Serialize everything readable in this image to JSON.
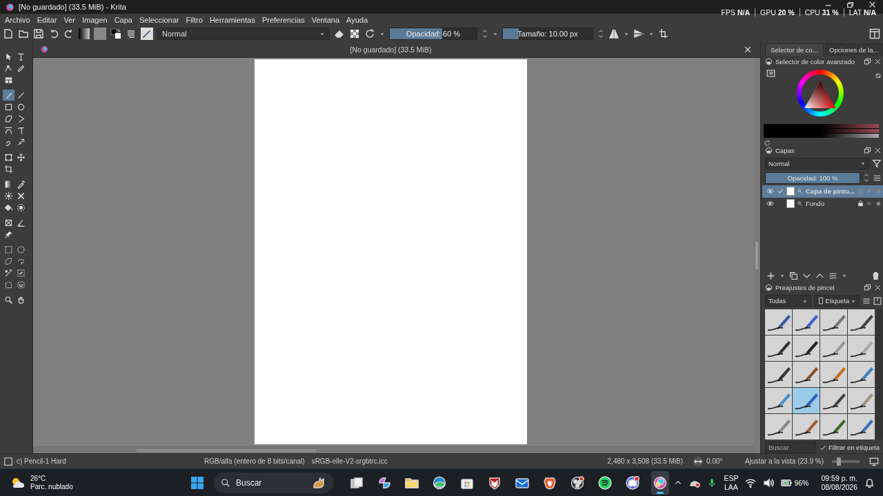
{
  "window": {
    "title": "[No guardado] (33.5 MiB) - Krita"
  },
  "performance": [
    {
      "label": "FPS",
      "value": "N/A"
    },
    {
      "label": "GPU",
      "value": "20 %"
    },
    {
      "label": "CPU",
      "value": "31 %"
    },
    {
      "label": "LAT",
      "value": "N/A"
    }
  ],
  "menu": [
    "Archivo",
    "Editar",
    "Ver",
    "Imagen",
    "Capa",
    "Seleccionar",
    "Filtro",
    "Herramientas",
    "Preferencias",
    "Ventana",
    "Ayuda"
  ],
  "toolbar": {
    "blend_mode": "Normal",
    "opacity": {
      "label": "Opacidad: 60 %",
      "level": 0.6
    },
    "size": {
      "label": "Tamaño: 10.00 px",
      "level": 0.18
    }
  },
  "document": {
    "tab_title": "[No guardado] (33.5 MiB)"
  },
  "toolbox": [
    {
      "tools": [
        {
          "kind": "pointer",
          "selected": false
        },
        {
          "kind": "text",
          "selected": false
        },
        {
          "kind": "edit-shapes",
          "selected": false
        },
        {
          "kind": "calligraphy",
          "selected": false
        },
        {
          "kind": "layout",
          "selected": false
        }
      ]
    },
    {
      "tools": [
        {
          "kind": "brush",
          "selected": true
        },
        {
          "kind": "line",
          "selected": false
        },
        {
          "kind": "rectangle",
          "selected": false
        },
        {
          "kind": "ellipse",
          "selected": false
        },
        {
          "kind": "polygon",
          "selected": false
        },
        {
          "kind": "polyline",
          "selected": false
        },
        {
          "kind": "bezier",
          "selected": false
        },
        {
          "kind": "freehand-path",
          "selected": false
        },
        {
          "kind": "dynamic-brush",
          "selected": false
        },
        {
          "kind": "multibrush",
          "selected": false
        }
      ]
    },
    {
      "tools": [
        {
          "kind": "transform",
          "selected": false
        },
        {
          "kind": "move",
          "selected": false
        },
        {
          "kind": "crop",
          "selected": false
        }
      ]
    },
    {
      "tools": [
        {
          "kind": "gradient",
          "selected": false
        },
        {
          "kind": "color-picker",
          "selected": false
        },
        {
          "kind": "smart-patch",
          "selected": false
        },
        {
          "kind": "sample",
          "selected": false
        },
        {
          "kind": "fill",
          "selected": false
        },
        {
          "kind": "enclose-fill",
          "selected": false
        }
      ]
    },
    {
      "tools": [
        {
          "kind": "assistant",
          "selected": false
        },
        {
          "kind": "measure",
          "selected": false
        },
        {
          "kind": "reference",
          "selected": false
        }
      ]
    },
    {
      "tools": [
        {
          "kind": "rect-select",
          "selected": false
        },
        {
          "kind": "ellipse-select",
          "selected": false
        },
        {
          "kind": "polygon-select",
          "selected": false
        },
        {
          "kind": "freehand-select",
          "selected": false
        },
        {
          "kind": "contiguous-select",
          "selected": false
        },
        {
          "kind": "similar-select",
          "selected": false
        },
        {
          "kind": "bezier-select",
          "selected": false
        },
        {
          "kind": "magnetic-select",
          "selected": false
        }
      ]
    },
    {
      "tools": [
        {
          "kind": "zoom",
          "selected": false
        },
        {
          "kind": "pan",
          "selected": false
        }
      ]
    }
  ],
  "dock_tabs": [
    {
      "label": "Selector de co...",
      "selected": true
    },
    {
      "label": "Opciones de la...",
      "selected": false
    }
  ],
  "color_selector": {
    "title": "Selector de color avanzado"
  },
  "layers": {
    "title": "Capas",
    "blend_mode": "Normal",
    "opacity": {
      "label": "Opacidad: 100 %",
      "level": 1
    },
    "items": [
      {
        "name": "Capa de pintu...",
        "selected": true,
        "visible": true,
        "locked": false
      },
      {
        "name": "Fondo",
        "selected": false,
        "visible": true,
        "locked": true
      }
    ]
  },
  "brush_presets": {
    "title": "Preajustes de pincel",
    "filter": "Todas",
    "tag": "Etiqueta",
    "presets": [
      {
        "selected": false
      },
      {
        "selected": false
      },
      {
        "selected": false
      },
      {
        "selected": false
      },
      {
        "selected": false
      },
      {
        "selected": false
      },
      {
        "selected": false
      },
      {
        "selected": false
      },
      {
        "selected": false
      },
      {
        "selected": false
      },
      {
        "selected": false
      },
      {
        "selected": false
      },
      {
        "selected": false
      },
      {
        "selected": true
      },
      {
        "selected": false
      },
      {
        "selected": false
      },
      {
        "selected": false
      },
      {
        "selected": false
      },
      {
        "selected": false
      },
      {
        "selected": false
      }
    ],
    "search": {
      "placeholder": "Buscar"
    },
    "filter_in_tag": {
      "label": "Filtrar en etiqueta",
      "checked": true
    }
  },
  "status_bar": {
    "preset": "c) Pencil-1 Hard",
    "color_space": "RGB/alfa (entero de 8 bits/canal)",
    "profile": "sRGB-elle-V2-srgbtrc.icc",
    "dimensions": "2,480 x 3,508 (33.5 MiB)",
    "rotation": "0.00°",
    "zoom": "Ajustar a la vista (23.9 %)",
    "zoom_slider": {
      "level": 0.25
    }
  },
  "taskbar": {
    "weather": {
      "temperature": "26°C",
      "condition": "Parc. nublado"
    },
    "search": {
      "placeholder": "Buscar"
    },
    "apps": [
      {
        "kind": "taskview",
        "active": false
      },
      {
        "kind": "swirl",
        "active": false
      },
      {
        "kind": "folder",
        "active": false
      },
      {
        "kind": "globe",
        "active": false
      },
      {
        "kind": "store",
        "active": false
      },
      {
        "kind": "shield",
        "active": false
      },
      {
        "kind": "mail",
        "active": false
      },
      {
        "kind": "lion",
        "active": false
      },
      {
        "kind": "record",
        "active": false
      },
      {
        "kind": "music",
        "active": false
      },
      {
        "kind": "chat",
        "active": false
      },
      {
        "kind": "paint",
        "active": true
      }
    ],
    "language": [
      "ESP",
      "LAA"
    ],
    "battery": "96%",
    "time": "09:59 p. m.",
    "date": "08/08/2026"
  }
}
